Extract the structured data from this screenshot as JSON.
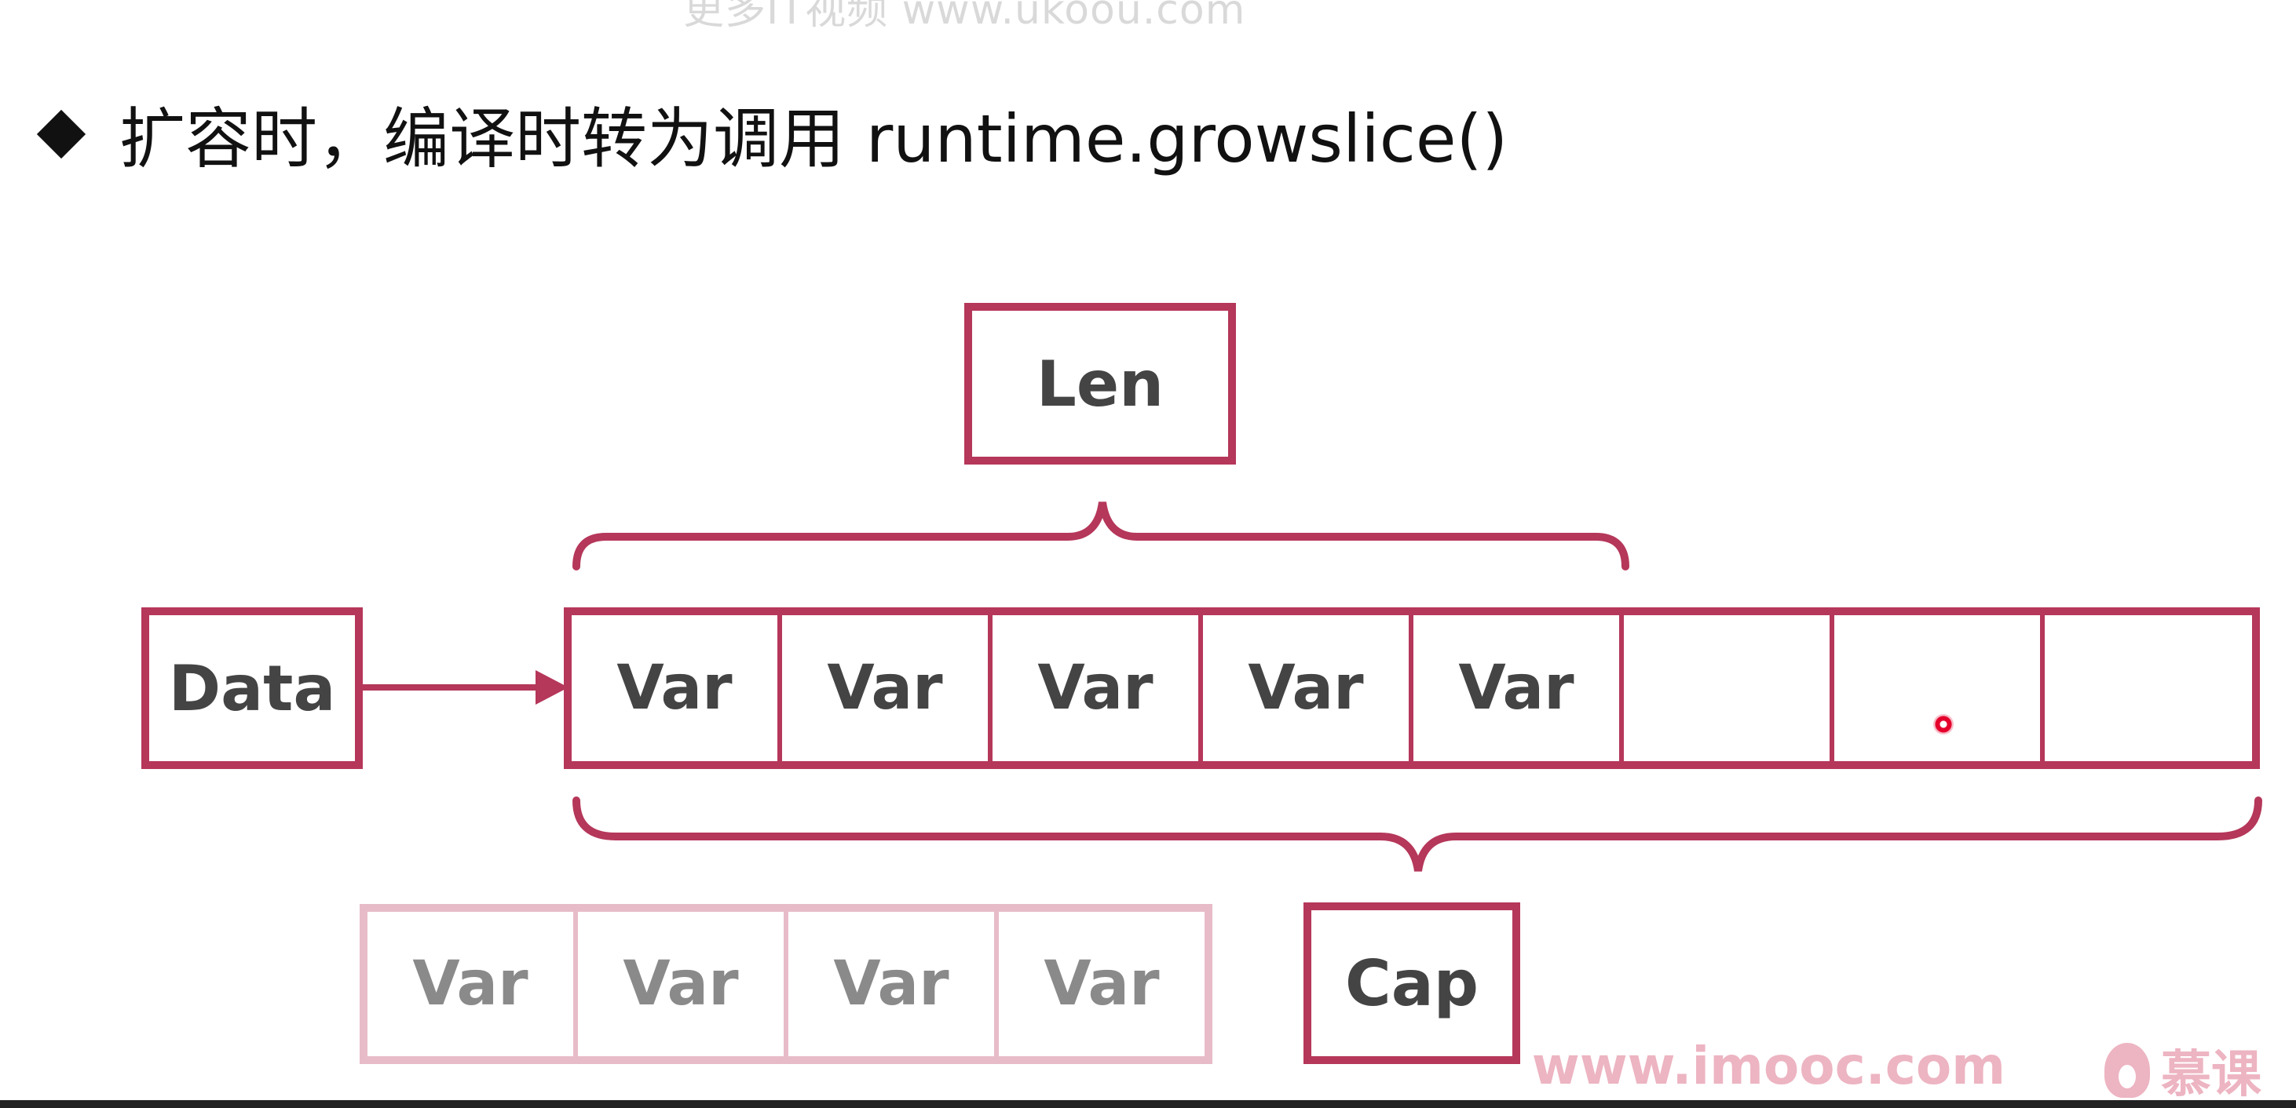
{
  "watermark": "更多IT视频 www.ukoou.com",
  "headline": "扩容时，编译时转为调用 runtime.growslice()",
  "labels": {
    "len": "Len",
    "data": "Data",
    "cap": "Cap"
  },
  "main_array": {
    "cells": [
      "Var",
      "Var",
      "Var",
      "Var",
      "Var",
      "",
      "",
      ""
    ]
  },
  "old_array": {
    "cells": [
      "Var",
      "Var",
      "Var",
      "Var"
    ]
  },
  "footer": {
    "url": "www.imooc.com",
    "brand": "慕课"
  },
  "colors": {
    "accent": "#b5375a",
    "ghost": "#e7bcc8",
    "text": "#444444"
  },
  "icons": [
    "diamond-bullet-icon",
    "arrow-right-icon",
    "brace-top-icon",
    "brace-bottom-icon",
    "imooc-flame-icon",
    "pointer-dot-icon"
  ]
}
